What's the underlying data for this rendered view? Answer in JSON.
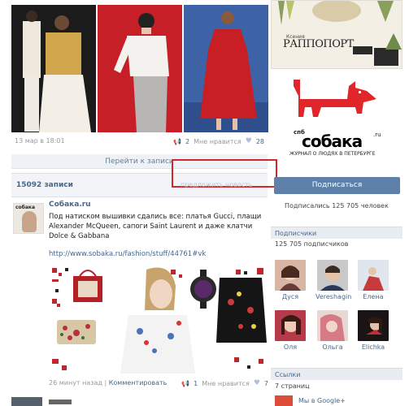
{
  "top_post": {
    "date": "13 мар в 18:01",
    "reposts": "2",
    "like_label": "Мне нравится",
    "likes": "28",
    "goto_label": "Перейти к записи"
  },
  "wall": {
    "count_label": "15092 записи",
    "suggest_label": "предложить новость"
  },
  "post": {
    "author": "Собака.ru",
    "avatar_text": "собака",
    "text": "Под натиском вышивки сдались все: платья Gucci, плащи Alexander McQueen, сапоги Saint Laurent и даже клатчи Dolce & Gabbana",
    "link": "http://www.sobaka.ru/fashion/stuff/44761#vk",
    "time": "26 минут назад",
    "comment_label": "Комментировать",
    "reposts": "1",
    "like_label": "Мне нравится",
    "likes": "7"
  },
  "sidebar": {
    "magazine_name_top": "Ксения",
    "magazine_name": "РАППОПОРТ",
    "brand_small": "спб",
    "brand": "собака",
    "brand_ru": ".ru",
    "brand_tagline": "ЖУРНАЛ О ЛЮДЯХ В ПЕТЕРБУРГЕ",
    "subscribe_label": "Подписаться",
    "subscribed_text": "Подписались 125 705 человек",
    "subscribers_head": "Подписчики",
    "subscribers_count": "125 705 подписчиков",
    "members": [
      {
        "name": "Дуся"
      },
      {
        "name": "Vereshagin"
      },
      {
        "name": "Елена"
      },
      {
        "name": "Оля"
      },
      {
        "name": "Ольга"
      },
      {
        "name": "Elichka"
      }
    ],
    "links_head": "Ссылки",
    "links_count": "7 страниц",
    "gplus_label": "Мы в Google+"
  },
  "colors": {
    "link": "#45688e",
    "button": "#5d81a8",
    "highlight_box": "#d2272b",
    "dog": "#e0262a"
  }
}
